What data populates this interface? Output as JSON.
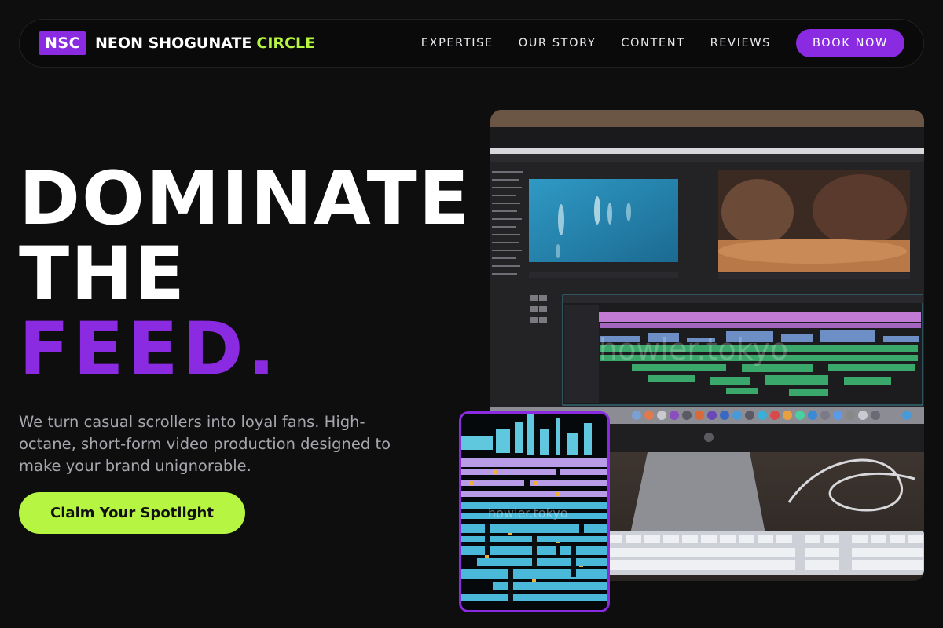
{
  "nav": {
    "logo": "NSC",
    "brand_main": "NEON SHOGUNATE",
    "brand_accent": "CIRCLE",
    "links": [
      "EXPERTISE",
      "OUR STORY",
      "CONTENT",
      "REVIEWS"
    ],
    "cta": "BOOK NOW"
  },
  "hero": {
    "headline_line1": "DOMINATE",
    "headline_line2": "THE",
    "headline_line3": "FEED.",
    "subtitle": "We turn casual scrollers into loyal fans. High-octane, short-form video production designed to make your brand unignorable.",
    "cta": "Claim Your Spotlight"
  },
  "images": {
    "main_watermark": "howler.tokyo",
    "secondary_watermark": "howler.tokyo"
  },
  "colors": {
    "background": "#0e0e0f",
    "purple": "#8a2be2",
    "lime": "#b6f542",
    "text_muted": "#a6a6ad"
  }
}
